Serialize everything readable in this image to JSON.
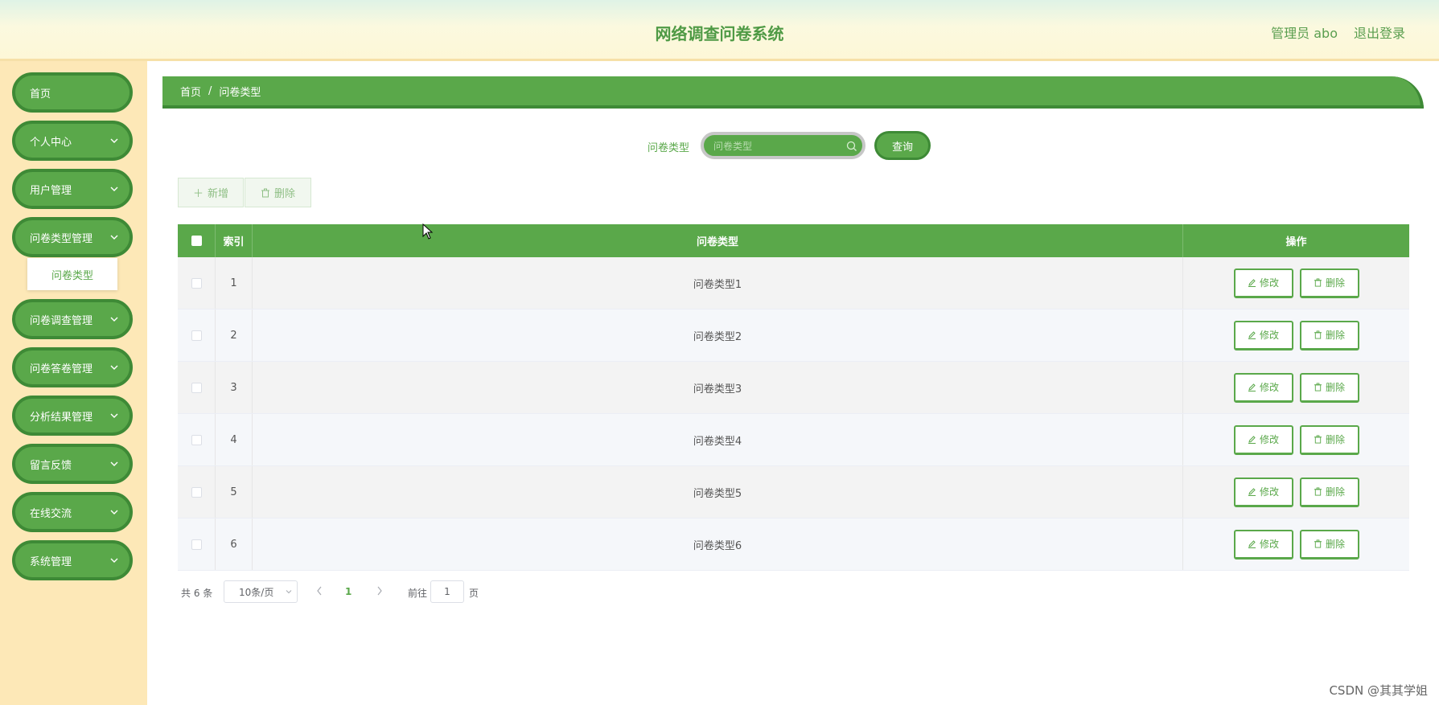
{
  "header": {
    "title": "网络调查问卷系统",
    "admin": "管理员 abo",
    "logout": "退出登录"
  },
  "sidebar": {
    "items": [
      {
        "label": "首页",
        "has_children": false
      },
      {
        "label": "个人中心",
        "has_children": true
      },
      {
        "label": "用户管理",
        "has_children": true
      },
      {
        "label": "问卷类型管理",
        "has_children": true
      },
      {
        "label": "问卷调查管理",
        "has_children": true
      },
      {
        "label": "问卷答卷管理",
        "has_children": true
      },
      {
        "label": "分析结果管理",
        "has_children": true
      },
      {
        "label": "留言反馈",
        "has_children": true
      },
      {
        "label": "在线交流",
        "has_children": true
      },
      {
        "label": "系统管理",
        "has_children": true
      }
    ],
    "submenu": {
      "label": "问卷类型"
    }
  },
  "breadcrumb": {
    "home": "首页",
    "separator": "/",
    "current": "问卷类型"
  },
  "search": {
    "label": "问卷类型",
    "placeholder": "问卷类型",
    "button": "查询"
  },
  "toolbar": {
    "add_label": "新增",
    "delete_label": "删除"
  },
  "table": {
    "headers": {
      "index": "索引",
      "type": "问卷类型",
      "ops": "操作"
    },
    "rows": [
      {
        "index": "1",
        "type": "问卷类型1"
      },
      {
        "index": "2",
        "type": "问卷类型2"
      },
      {
        "index": "3",
        "type": "问卷类型3"
      },
      {
        "index": "4",
        "type": "问卷类型4"
      },
      {
        "index": "5",
        "type": "问卷类型5"
      },
      {
        "index": "6",
        "type": "问卷类型6"
      }
    ],
    "edit_label": "修改",
    "delete_label": "删除"
  },
  "pagination": {
    "total": "共 6 条",
    "page_size": "10条/页",
    "current_page": "1",
    "goto_label": "前往",
    "goto_value": "1",
    "page_unit": "页"
  },
  "watermark": "CSDN @其其学姐",
  "colors": {
    "primary": "#5aa84a",
    "primary_dark": "#3e8a36",
    "sidebar_bg": "#fde8b7"
  }
}
